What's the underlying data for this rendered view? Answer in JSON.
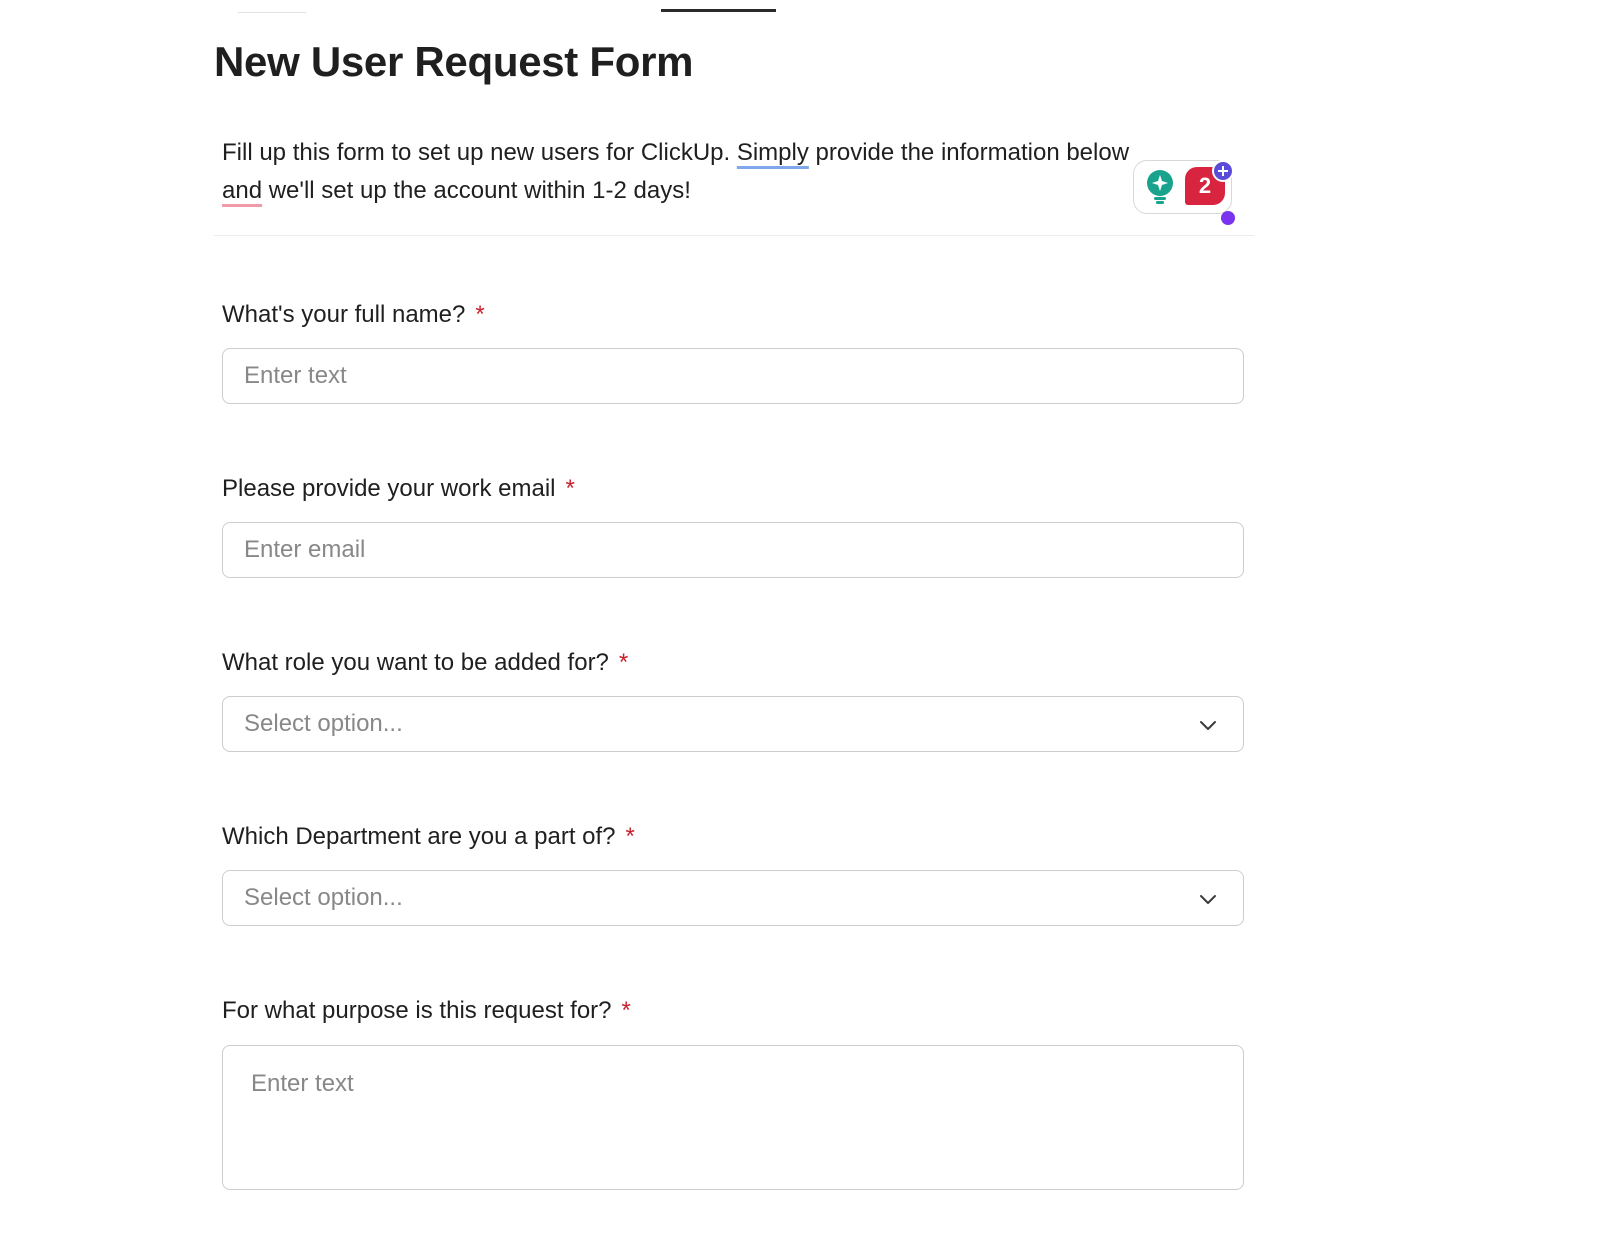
{
  "form": {
    "title": "New User Request Form",
    "description": {
      "part1": "Fill up this form to set up new users for ClickUp. ",
      "word_simply": "Simply",
      "part2": " provide the information below ",
      "word_and": "and",
      "part3": " we'll set up the account within 1-2 days!"
    }
  },
  "grammar_widget": {
    "suggestion_count": "2",
    "icons": [
      "lightbulb-icon",
      "plus-icon"
    ],
    "colors": {
      "bulb": "#1aa38c",
      "badge": "#d8243f",
      "plus": "#5b4bd8",
      "dot": "#7a34f0"
    }
  },
  "fields": {
    "full_name": {
      "label": "What's your full name?",
      "required": "*",
      "placeholder": "Enter text"
    },
    "work_email": {
      "label": "Please provide your work email",
      "required": "*",
      "placeholder": "Enter email"
    },
    "role": {
      "label": "What role you want to be added for?",
      "required": "*",
      "placeholder": "Select option..."
    },
    "department": {
      "label": "Which Department are you a part of?",
      "required": "*",
      "placeholder": "Select option..."
    },
    "purpose": {
      "label": "For what purpose is this request for?",
      "required": "*",
      "placeholder": "Enter text"
    }
  }
}
